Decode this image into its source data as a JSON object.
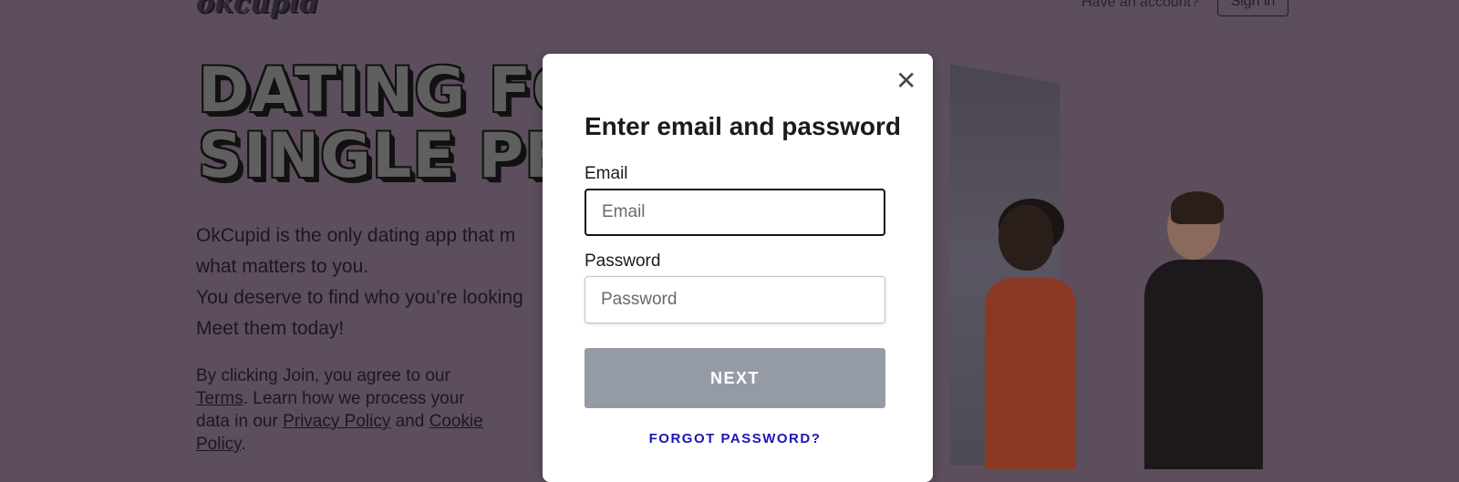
{
  "header": {
    "logo": "okcupid",
    "have_account": "Have an account?",
    "sign_in": "Sign in"
  },
  "hero": {
    "headline_line1": "DATING FO",
    "headline_line2": "SINGLE PE",
    "body_line1": "OkCupid is the only dating app that m",
    "body_line2": "what matters to you.",
    "body_line3": "You deserve to find who you’re looking",
    "body_line4": "Meet them today!"
  },
  "legal": {
    "prefix": "By clicking Join, you agree to our ",
    "terms": "Terms",
    "middle": ". Learn how we process your data in our ",
    "privacy": "Privacy Policy",
    "and": " and ",
    "cookie": "Cookie Policy",
    "suffix": "."
  },
  "modal": {
    "close_symbol": "✕",
    "title": "Enter email and password",
    "email_label": "Email",
    "email_placeholder": "Email",
    "email_value": "",
    "password_label": "Password",
    "password_placeholder": "Password",
    "password_value": "",
    "next_label": "NEXT",
    "forgot_label": "FORGOT PASSWORD?"
  },
  "colors": {
    "overlay_bg": "#5c4e5c",
    "next_button_disabled": "#959ba5",
    "link_blue": "#1a16b8"
  }
}
